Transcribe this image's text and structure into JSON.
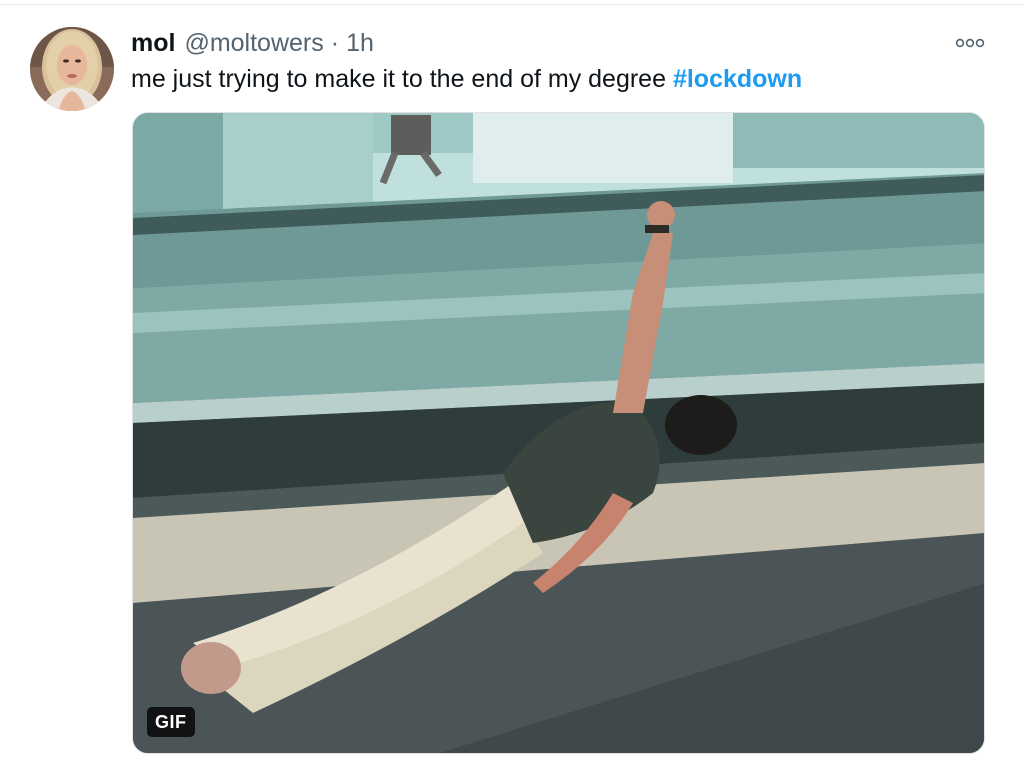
{
  "tweet": {
    "display_name": "mol",
    "handle": "@moltowers",
    "separator": "·",
    "time": "1h",
    "text": "me just trying to make it to the end of my degree",
    "hashtag": "#lockdown",
    "media": {
      "type_badge": "GIF"
    },
    "more_icon": "more-options-icon"
  },
  "colors": {
    "name": "#0f1419",
    "muted": "#536471",
    "hashtag": "#1d9bf0"
  }
}
